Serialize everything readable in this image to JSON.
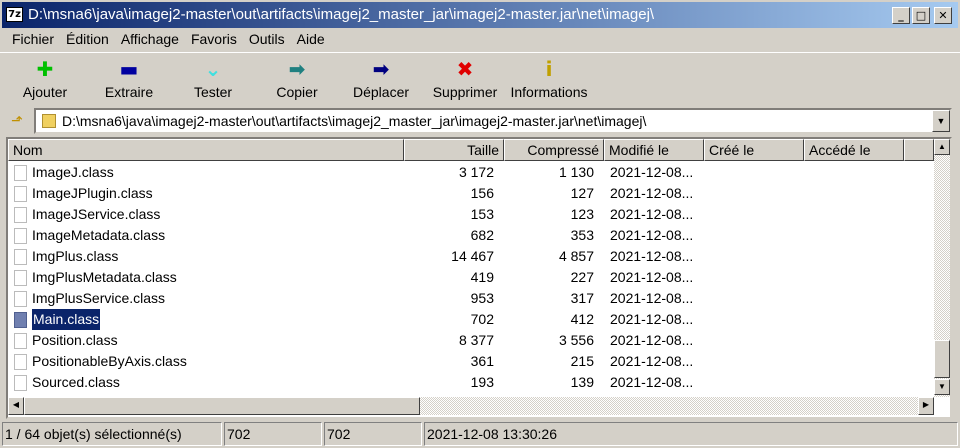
{
  "window": {
    "title": "D:\\msna6\\java\\imagej2-master\\out\\artifacts\\imagej2_master_jar\\imagej2-master.jar\\net\\imagej\\",
    "icon_label": "7z",
    "buttons": [
      "_",
      "□",
      "✕"
    ]
  },
  "menu": [
    "Fichier",
    "Édition",
    "Affichage",
    "Favoris",
    "Outils",
    "Aide"
  ],
  "toolbar": [
    {
      "label": "Ajouter",
      "icon": "plus-icon",
      "glyph": "✚",
      "color": "#00c000"
    },
    {
      "label": "Extraire",
      "icon": "minus-icon",
      "glyph": "▬",
      "color": "#0000a0"
    },
    {
      "label": "Tester",
      "icon": "check-chevron-icon",
      "glyph": "⌄",
      "color": "#40e0e0"
    },
    {
      "label": "Copier",
      "icon": "copy-arrow-icon",
      "glyph": "➡",
      "color": "#208080"
    },
    {
      "label": "Déplacer",
      "icon": "move-arrow-icon",
      "glyph": "➡",
      "color": "#000080"
    },
    {
      "label": "Supprimer",
      "icon": "delete-x-icon",
      "glyph": "✖",
      "color": "#e00000"
    },
    {
      "label": "Informations",
      "icon": "info-icon",
      "glyph": "i",
      "color": "#c0a000"
    }
  ],
  "address": {
    "value": "D:\\msna6\\java\\imagej2-master\\out\\artifacts\\imagej2_master_jar\\imagej2-master.jar\\net\\imagej\\"
  },
  "columns": [
    "Nom",
    "Taille",
    "Compressé",
    "Modifié le",
    "Créé le",
    "Accédé le"
  ],
  "files": [
    {
      "name": "ImageJ.class",
      "size": "3 172",
      "packed": "1 130",
      "modified": "2021-12-08..."
    },
    {
      "name": "ImageJPlugin.class",
      "size": "156",
      "packed": "127",
      "modified": "2021-12-08..."
    },
    {
      "name": "ImageJService.class",
      "size": "153",
      "packed": "123",
      "modified": "2021-12-08..."
    },
    {
      "name": "ImageMetadata.class",
      "size": "682",
      "packed": "353",
      "modified": "2021-12-08..."
    },
    {
      "name": "ImgPlus.class",
      "size": "14 467",
      "packed": "4 857",
      "modified": "2021-12-08..."
    },
    {
      "name": "ImgPlusMetadata.class",
      "size": "419",
      "packed": "227",
      "modified": "2021-12-08..."
    },
    {
      "name": "ImgPlusService.class",
      "size": "953",
      "packed": "317",
      "modified": "2021-12-08..."
    },
    {
      "name": "Main.class",
      "size": "702",
      "packed": "412",
      "modified": "2021-12-08...",
      "selected": true
    },
    {
      "name": "Position.class",
      "size": "8 377",
      "packed": "3 556",
      "modified": "2021-12-08..."
    },
    {
      "name": "PositionableByAxis.class",
      "size": "361",
      "packed": "215",
      "modified": "2021-12-08..."
    },
    {
      "name": "Sourced.class",
      "size": "193",
      "packed": "139",
      "modified": "2021-12-08..."
    }
  ],
  "status": {
    "selection": "1 / 64 objet(s) sélectionné(s)",
    "size": "702",
    "packed": "702",
    "modified": "2021-12-08 13:30:26"
  }
}
